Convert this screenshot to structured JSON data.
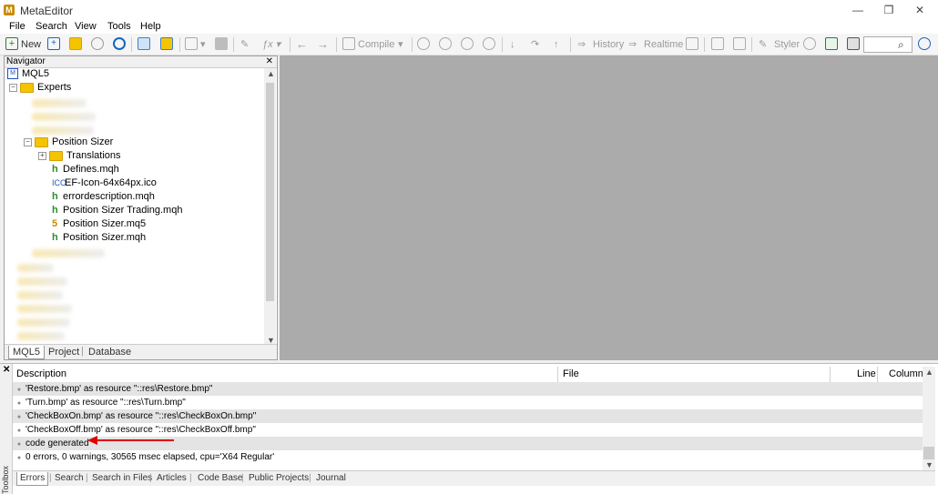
{
  "window": {
    "title": "MetaEditor",
    "minimize": "—",
    "restore": "❐",
    "close": "✕"
  },
  "menu": [
    "File",
    "Search",
    "View",
    "Tools",
    "Help"
  ],
  "toolbar": {
    "new_label": "New",
    "compile_label": "Compile",
    "history_label": "History",
    "realtime_label": "Realtime",
    "styler_label": "Styler",
    "search_value": ""
  },
  "navigator": {
    "title": "Navigator",
    "root": "MQL5",
    "experts": "Experts",
    "position_sizer": "Position Sizer",
    "files": [
      {
        "type": "folder",
        "name": "Translations"
      },
      {
        "type": "h",
        "name": "Defines.mqh"
      },
      {
        "type": "ico",
        "name": "EF-Icon-64x64px.ico"
      },
      {
        "type": "h",
        "name": "errordescription.mqh"
      },
      {
        "type": "h",
        "name": "Position Sizer Trading.mqh"
      },
      {
        "type": "5",
        "name": "Position Sizer.mq5"
      },
      {
        "type": "h",
        "name": "Position Sizer.mqh"
      }
    ],
    "tabs": [
      "MQL5",
      "Project",
      "Database"
    ]
  },
  "toolbox": {
    "label": "Toolbox",
    "columns": {
      "description": "Description",
      "file": "File",
      "line": "Line",
      "column": "Column"
    },
    "messages": [
      "'Restore.bmp' as resource \"::res\\Restore.bmp\"",
      "'Turn.bmp' as resource \"::res\\Turn.bmp\"",
      "'CheckBoxOn.bmp' as resource \"::res\\CheckBoxOn.bmp\"",
      "'CheckBoxOff.bmp' as resource \"::res\\CheckBoxOff.bmp\"",
      "code generated",
      "0 errors, 0 warnings, 30565 msec elapsed, cpu='X64 Regular'"
    ],
    "tabs": [
      "Errors",
      "Search",
      "Search in Files",
      "Articles",
      "Code Base",
      "Public Projects",
      "Journal"
    ]
  }
}
